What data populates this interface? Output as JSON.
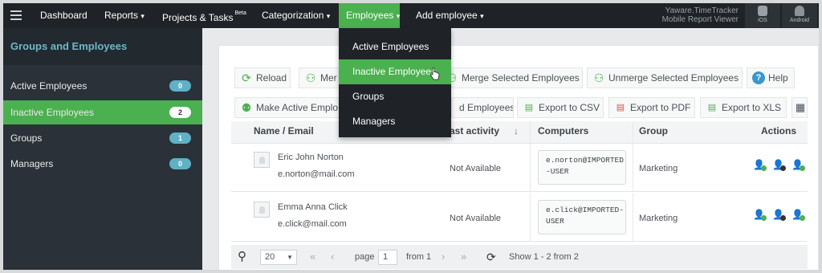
{
  "nav": {
    "dashboard": "Dashboard",
    "reports": "Reports",
    "projects": "Projects & Tasks",
    "projects_sup": "Beta",
    "categorization": "Categorization",
    "employees": "Employees",
    "add_employee": "Add employee",
    "brand_line1": "Yaware.TimeTracker",
    "brand_line2": "Mobile Report Viewer",
    "ios": "iOS",
    "android": "Android",
    "caret": "▾"
  },
  "sidebar": {
    "title": "Groups and Employees",
    "items": [
      {
        "label": "Active Employees",
        "count": "0"
      },
      {
        "label": "Inactive Employees",
        "count": "2"
      },
      {
        "label": "Groups",
        "count": "1"
      },
      {
        "label": "Managers",
        "count": "0"
      }
    ]
  },
  "toolbar": {
    "reload": "Reload",
    "merge_partial": "Mer",
    "merge_selected": "Merge Selected Employees",
    "unmerge_selected": "Unmerge Selected Employees",
    "help": "Help",
    "make_active": "Make Active Emplo",
    "d_employees": "d Employees",
    "export_csv": "Export to CSV",
    "export_pdf": "Export to PDF",
    "export_xls": "Export to XLS"
  },
  "table": {
    "headers": {
      "name": "Name / Email",
      "activity": "ast activity",
      "computers": "Computers",
      "group": "Group",
      "actions": "Actions"
    },
    "rows": [
      {
        "name": "Eric John Norton",
        "email": "e.norton@mail.com",
        "activity": "Not Available",
        "computer": "e.norton@IMPORTED-USER",
        "group": "Marketing"
      },
      {
        "name": "Emma Anna Click",
        "email": "e.click@mail.com",
        "activity": "Not Available",
        "computer": "e.click@IMPORTED-USER",
        "group": "Marketing"
      }
    ]
  },
  "pager": {
    "per_page": "20",
    "page_label": "page",
    "page": "1",
    "from": "from 1",
    "summary": "Show 1 - 2 from 2"
  },
  "dropdown": {
    "items": [
      "Active Employees",
      "Inactive Employees",
      "Groups",
      "Managers"
    ],
    "highlighted": "Inactive Employees"
  },
  "colors": {
    "accent": "#4bb04f",
    "nav_bg": "#1f2327",
    "sidebar_bg": "#2a3138",
    "badge": "#5fb1c6"
  }
}
